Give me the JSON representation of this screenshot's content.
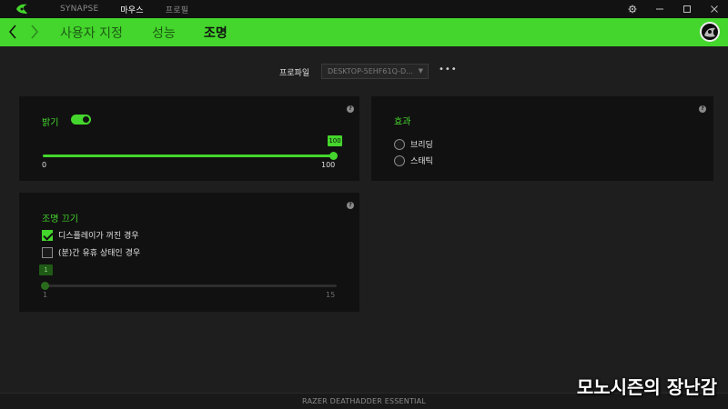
{
  "titlebar": {
    "nav": [
      "SYNAPSE",
      "마우스",
      "프로필"
    ],
    "active_nav": "마우스"
  },
  "header": {
    "tabs": [
      "사용자 지정",
      "성능",
      "조명"
    ],
    "active_tab": "조명",
    "accent_color": "#44d62c"
  },
  "profile": {
    "label": "프로파일",
    "selected": "DESKTOP-5EHF61Q-D...",
    "more": "•••"
  },
  "brightness": {
    "title": "밝기",
    "enabled": true,
    "value": 100,
    "min": "0",
    "max": "100",
    "tooltip": "100",
    "help": "?"
  },
  "effect": {
    "title": "효과",
    "options": [
      "브리딩",
      "스태틱"
    ],
    "help": "?"
  },
  "lighting_off": {
    "title": "조명 끄기",
    "option_display_off": {
      "label": "디스플레이가 꺼진 경우",
      "checked": true
    },
    "option_idle": {
      "label": "(분)간 유휴 상태인 경우",
      "checked": false
    },
    "slider_value": 1,
    "min": "1",
    "max": "15",
    "tooltip": "1",
    "help": "?"
  },
  "footer": {
    "device": "RAZER DEATHADDER ESSENTIAL"
  },
  "watermark": "모노시즌의 장난감"
}
